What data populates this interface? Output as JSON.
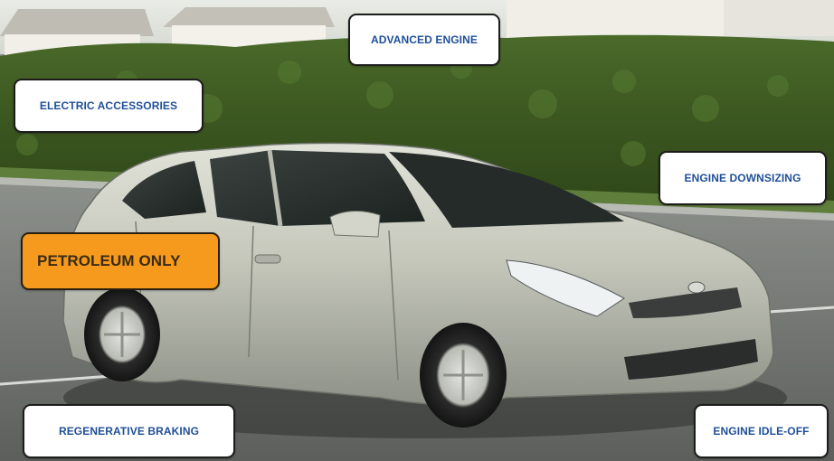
{
  "labels": {
    "advanced_engine": "ADVANCED ENGINE",
    "electric_accessories": "ELECTRIC ACCESSORIES",
    "engine_downsizing": "ENGINE DOWNSIZING",
    "petroleum_only": "PETROLEUM ONLY",
    "regenerative_braking": "REGENERATIVE BRAKING",
    "engine_idle_off": "ENGINE IDLE-OFF"
  },
  "active_label": "petroleum_only",
  "colors": {
    "label_text": "#1f4f98",
    "label_bg": "#ffffff",
    "active_bg": "#f59a1c",
    "car_body": "#c9cbbf",
    "hedge": "#3d5a22"
  },
  "photo_subject": "silver-hybrid-hatchback"
}
